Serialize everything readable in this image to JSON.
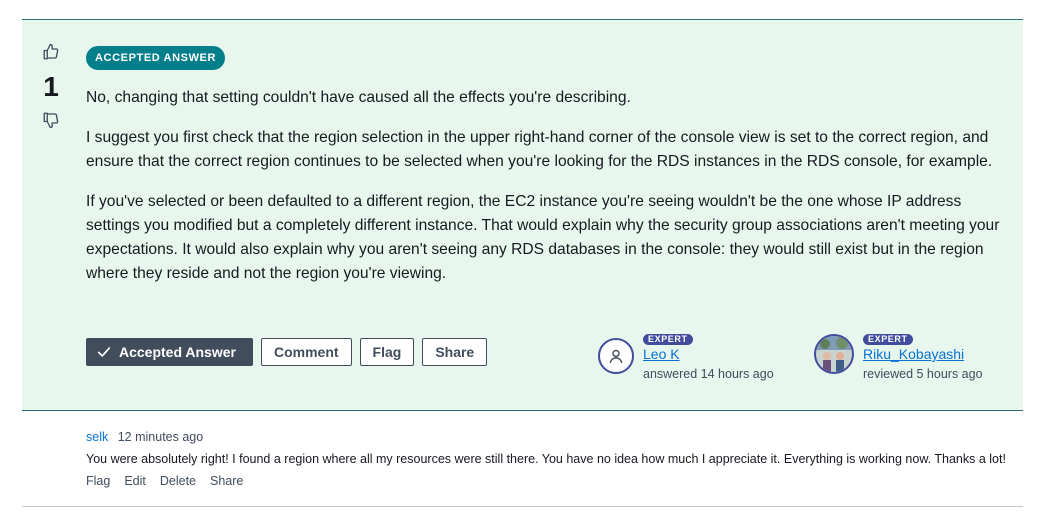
{
  "answer": {
    "accepted_badge": "ACCEPTED ANSWER",
    "vote_count": "1",
    "paragraphs": [
      "No, changing that setting couldn't have caused all the effects you're describing.",
      "I suggest you first check that the region selection in the upper right-hand corner of the console view is set to the correct region, and ensure that the correct region continues to be selected when you're looking for the RDS instances in the RDS console, for example.",
      "If you've selected or been defaulted to a different region, the EC2 instance you're seeing wouldn't be the one whose IP address settings you modified but a completely different instance. That would explain why the security group associations aren't meeting your expectations. It would also explain why you aren't seeing any RDS databases in the console: they would still exist but in the region where they reside and not the region you're viewing."
    ],
    "buttons": {
      "accepted": "Accepted Answer",
      "comment": "Comment",
      "flag": "Flag",
      "share": "Share"
    },
    "answerer": {
      "badge": "EXPERT",
      "name": "Leo K",
      "status": "answered 14 hours ago",
      "icon": "user-icon"
    },
    "reviewer": {
      "badge": "EXPERT",
      "name": "Riku_Kobayashi",
      "status": "reviewed 5 hours ago",
      "icon": "profile-photo"
    }
  },
  "comment": {
    "author": "selk",
    "time": "12 minutes ago",
    "text": "You were absolutely right! I found a region where all my resources were still there. You have no idea how much I appreciate it. Everything is working now. Thanks a lot!",
    "actions": [
      "Flag",
      "Edit",
      "Delete",
      "Share"
    ]
  },
  "colors": {
    "card_background": "#e8f7ee",
    "accepted_badge": "#037f8c",
    "accepted_button": "#414d5c",
    "expert_badge": "#414d9c",
    "link": "#0972d3"
  }
}
